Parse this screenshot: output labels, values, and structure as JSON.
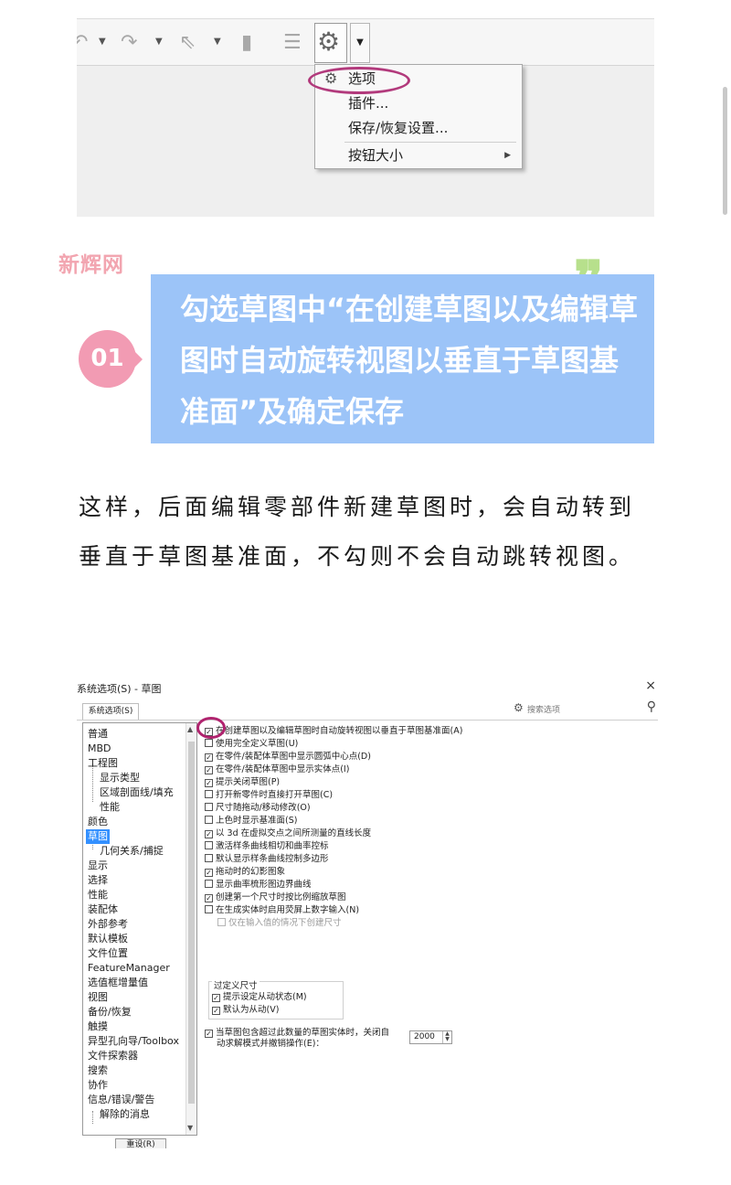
{
  "toolbar_menu": {
    "items": [
      {
        "label": "选项",
        "icon": "gear-icon"
      },
      {
        "label": "插件..."
      },
      {
        "label": "保存/恢复设置..."
      },
      {
        "label": "按钮大小",
        "has_submenu": true
      }
    ]
  },
  "watermark": "新辉网",
  "step": {
    "number": "01",
    "text": "勾选草图中“在创建草图以及编辑草图时自动旋转视图以垂直于草图基准面”及确定保存"
  },
  "paragraph": "这样，后面编辑零部件新建草图时，会自动转到垂直于草图基准面，不勾则不会自动跳转视图。",
  "dialog": {
    "title": "系统选项(S) - 草图",
    "close": "×",
    "tab": "系统选项(S)",
    "search_placeholder": "搜索选项",
    "tree": [
      {
        "label": "普通"
      },
      {
        "label": "MBD"
      },
      {
        "label": "工程图"
      },
      {
        "label": "显示类型",
        "indent": true
      },
      {
        "label": "区域剖面线/填充",
        "indent": true
      },
      {
        "label": "性能",
        "indent": true
      },
      {
        "label": "颜色"
      },
      {
        "label": "草图",
        "selected": true
      },
      {
        "label": "几何关系/捕捉",
        "indent": true
      },
      {
        "label": "显示"
      },
      {
        "label": "选择"
      },
      {
        "label": "性能"
      },
      {
        "label": "装配体"
      },
      {
        "label": "外部参考"
      },
      {
        "label": "默认模板"
      },
      {
        "label": "文件位置"
      },
      {
        "label": "FeatureManager"
      },
      {
        "label": "选值框增量值"
      },
      {
        "label": "视图"
      },
      {
        "label": "备份/恢复"
      },
      {
        "label": "触摸"
      },
      {
        "label": "异型孔向导/Toolbox"
      },
      {
        "label": "文件探索器"
      },
      {
        "label": "搜索"
      },
      {
        "label": "协作"
      },
      {
        "label": "信息/错误/警告"
      },
      {
        "label": "解除的消息",
        "indent": true
      }
    ],
    "bottom_button": "重设(R)",
    "options": [
      {
        "label": "在创建草图以及编辑草图时自动旋转视图以垂直于草图基准面(A)",
        "checked": true
      },
      {
        "label": "使用完全定义草图(U)",
        "checked": false
      },
      {
        "label": "在零件/装配体草图中显示圆弧中心点(D)",
        "checked": true
      },
      {
        "label": "在零件/装配体草图中显示实体点(I)",
        "checked": true
      },
      {
        "label": "提示关闭草图(P)",
        "checked": true
      },
      {
        "label": "打开新零件时直接打开草图(C)",
        "checked": false
      },
      {
        "label": "尺寸随拖动/移动修改(O)",
        "checked": false
      },
      {
        "label": "上色时显示基准面(S)",
        "checked": false
      },
      {
        "label": "以 3d 在虚拟交点之间所测量的直线长度",
        "checked": true
      },
      {
        "label": "激活样条曲线相切和曲率控标",
        "checked": false
      },
      {
        "label": "默认显示样条曲线控制多边形",
        "checked": false
      },
      {
        "label": "拖动时的幻影图象",
        "checked": true
      },
      {
        "label": "显示曲率梳形图边界曲线",
        "checked": false
      },
      {
        "label": "创建第一个尺寸时按比例缩放草图",
        "checked": true
      },
      {
        "label": "在生成实体时启用荧屏上数字输入(N)",
        "checked": false
      },
      {
        "label": "仅在输入值的情况下创建尺寸",
        "checked": false,
        "disabled": true
      }
    ],
    "overdefine": {
      "title": "过定义尺寸",
      "items": [
        {
          "label": "提示设定从动状态(M)",
          "checked": true
        },
        {
          "label": "默认为从动(V)",
          "checked": true
        }
      ]
    },
    "limit_option": {
      "line1": "当草图包含超过此数量的草图实体时，关闭自",
      "line2": "动求解模式并撤销操作(E)：",
      "checked": true,
      "value": "2000"
    }
  }
}
